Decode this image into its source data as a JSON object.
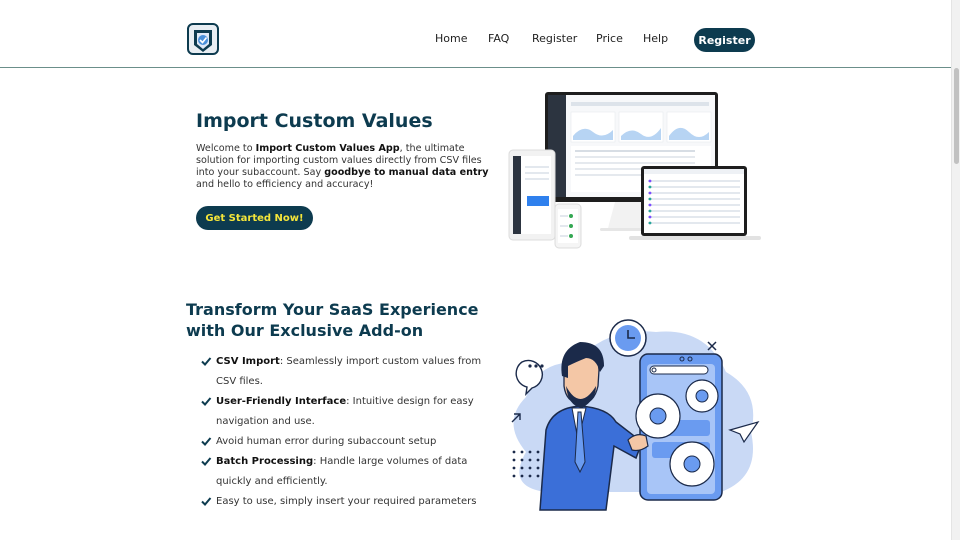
{
  "header": {
    "nav": [
      "Home",
      "FAQ",
      "Register",
      "Price",
      "Help"
    ],
    "register_button": "Register"
  },
  "hero": {
    "title": "Import Custom Values",
    "desc_1": "Welcome to ",
    "desc_app": "Import Custom Values App",
    "desc_2": ", the ultimate solution for importing custom values directly from CSV files into your subaccount. Say ",
    "desc_bold2": "goodbye to manual data entry",
    "desc_3": " and hello to efficiency and accuracy!",
    "cta": "Get Started Now!"
  },
  "features": {
    "title": "Transform Your SaaS Experience with Our Exclusive Add-on",
    "items": [
      {
        "bold": "CSV Import",
        "text": ": Seamlessly import custom values from CSV files."
      },
      {
        "bold": "User-Friendly Interface",
        "text": ": Intuitive design for easy navigation and use."
      },
      {
        "bold": "",
        "text": "Avoid human error during subaccount setup"
      },
      {
        "bold": "Batch Processing",
        "text": ": Handle large volumes of data quickly and efficiently."
      },
      {
        "bold": "",
        "text": "Easy to use, simply insert your required parameters"
      }
    ]
  },
  "colors": {
    "primary": "#0d3b4f",
    "cta_text": "#f5e63a",
    "illustration_blue": "#3b6fd8",
    "illustration_light": "#c9d9f5"
  },
  "icons": [
    "app-logo-icon",
    "checkmark-icon"
  ]
}
